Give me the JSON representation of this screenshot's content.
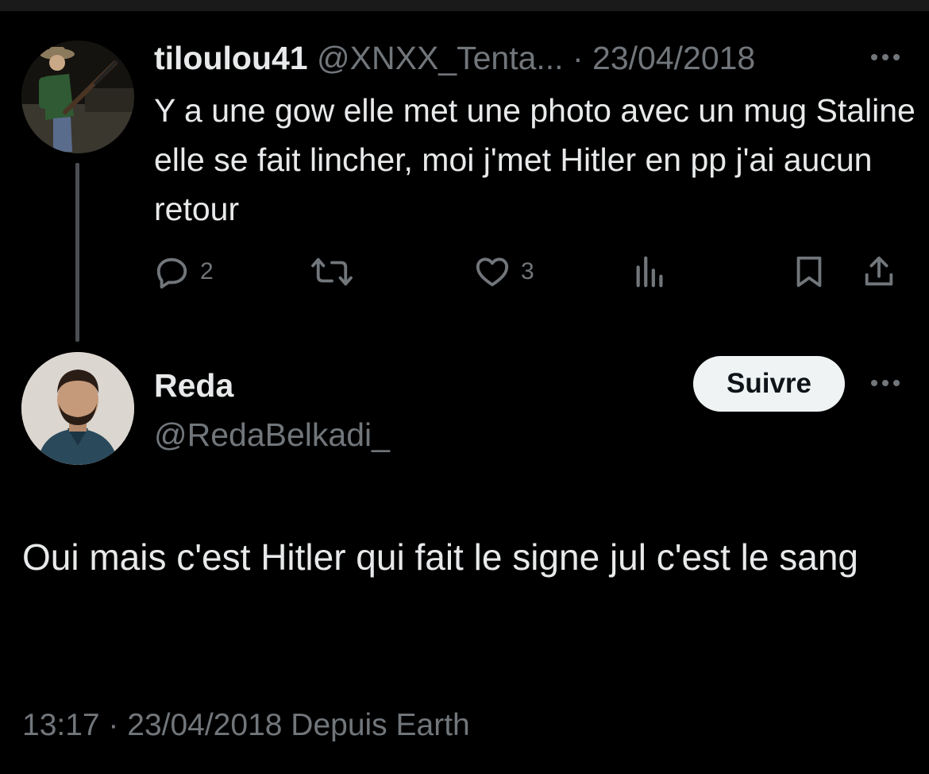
{
  "parent_tweet": {
    "display_name": "tiloulou41",
    "handle": "@XNXX_Tenta...",
    "separator": "·",
    "date": "23/04/2018",
    "text": "Y a une gow elle met une photo avec un mug Staline elle se fait lincher, moi j'met Hitler en pp j'ai aucun retour",
    "actions": {
      "reply_count": "2",
      "retweet_count": "",
      "like_count": "3"
    },
    "icons": [
      "more-icon",
      "reply-icon",
      "retweet-icon",
      "like-icon",
      "views-icon",
      "bookmark-icon",
      "share-icon"
    ]
  },
  "reply_tweet": {
    "display_name": "Reda",
    "handle": "@RedaBelkadi_",
    "follow_label": "Suivre",
    "text": "Oui mais c'est Hitler qui fait le signe jul c'est le sang",
    "meta": "13:17 · 23/04/2018 Depuis Earth"
  },
  "colors": {
    "background": "#000000",
    "primary_text": "#e7e9ea",
    "secondary_text": "#71767b",
    "follow_button_bg": "#eff3f4",
    "follow_button_text": "#0f1419",
    "thread_line": "#4a4e52"
  }
}
